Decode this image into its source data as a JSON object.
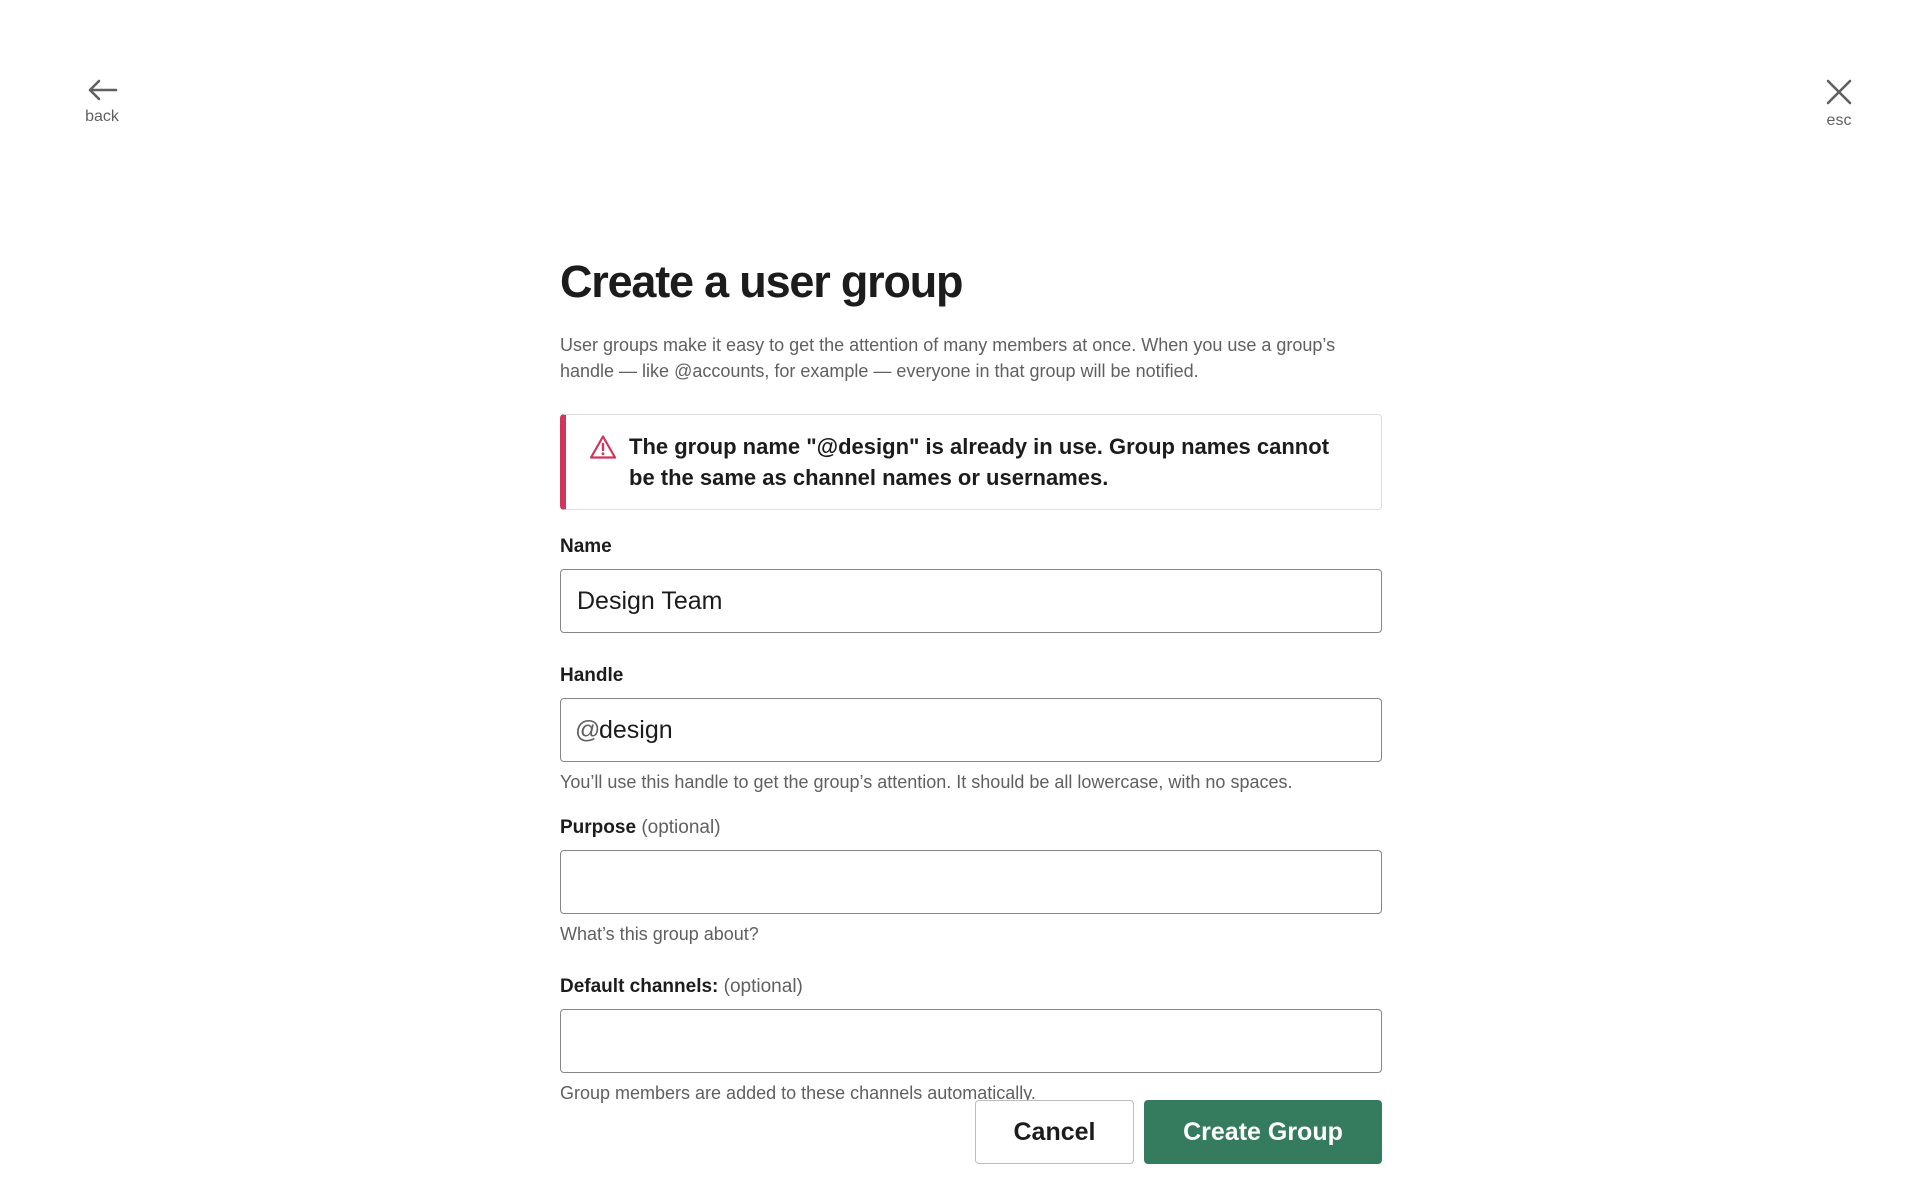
{
  "nav": {
    "back_label": "back",
    "esc_label": "esc"
  },
  "page": {
    "title": "Create a user group",
    "intro": "User groups make it easy to get the attention of many members at once. When you use a group’s handle — like @accounts, for example — everyone in that group will be notified."
  },
  "alert": {
    "message": "The group name \"@design\" is already in use. Group names cannot be the same as channel names or usernames."
  },
  "form": {
    "name": {
      "label": "Name",
      "value": "Design Team"
    },
    "handle": {
      "label": "Handle",
      "prefix": "@",
      "value": "design",
      "help": "You’ll use this handle to get the group’s attention. It should be all lowercase, with no spaces."
    },
    "purpose": {
      "label": "Purpose",
      "optional": "(optional)",
      "value": "",
      "help": "What’s this group about?"
    },
    "channels": {
      "label": "Default channels:",
      "optional": "(optional)",
      "value": "",
      "help": "Group members are added to these channels automatically."
    }
  },
  "actions": {
    "cancel_label": "Cancel",
    "create_label": "Create Group"
  },
  "colors": {
    "accent_green": "#357b5e",
    "alert_red": "#d0365b",
    "text": "#1d1c1d",
    "muted": "#616061"
  },
  "icons": {
    "back": "arrow-left-icon",
    "close": "close-icon",
    "alert": "warning-triangle-icon"
  }
}
